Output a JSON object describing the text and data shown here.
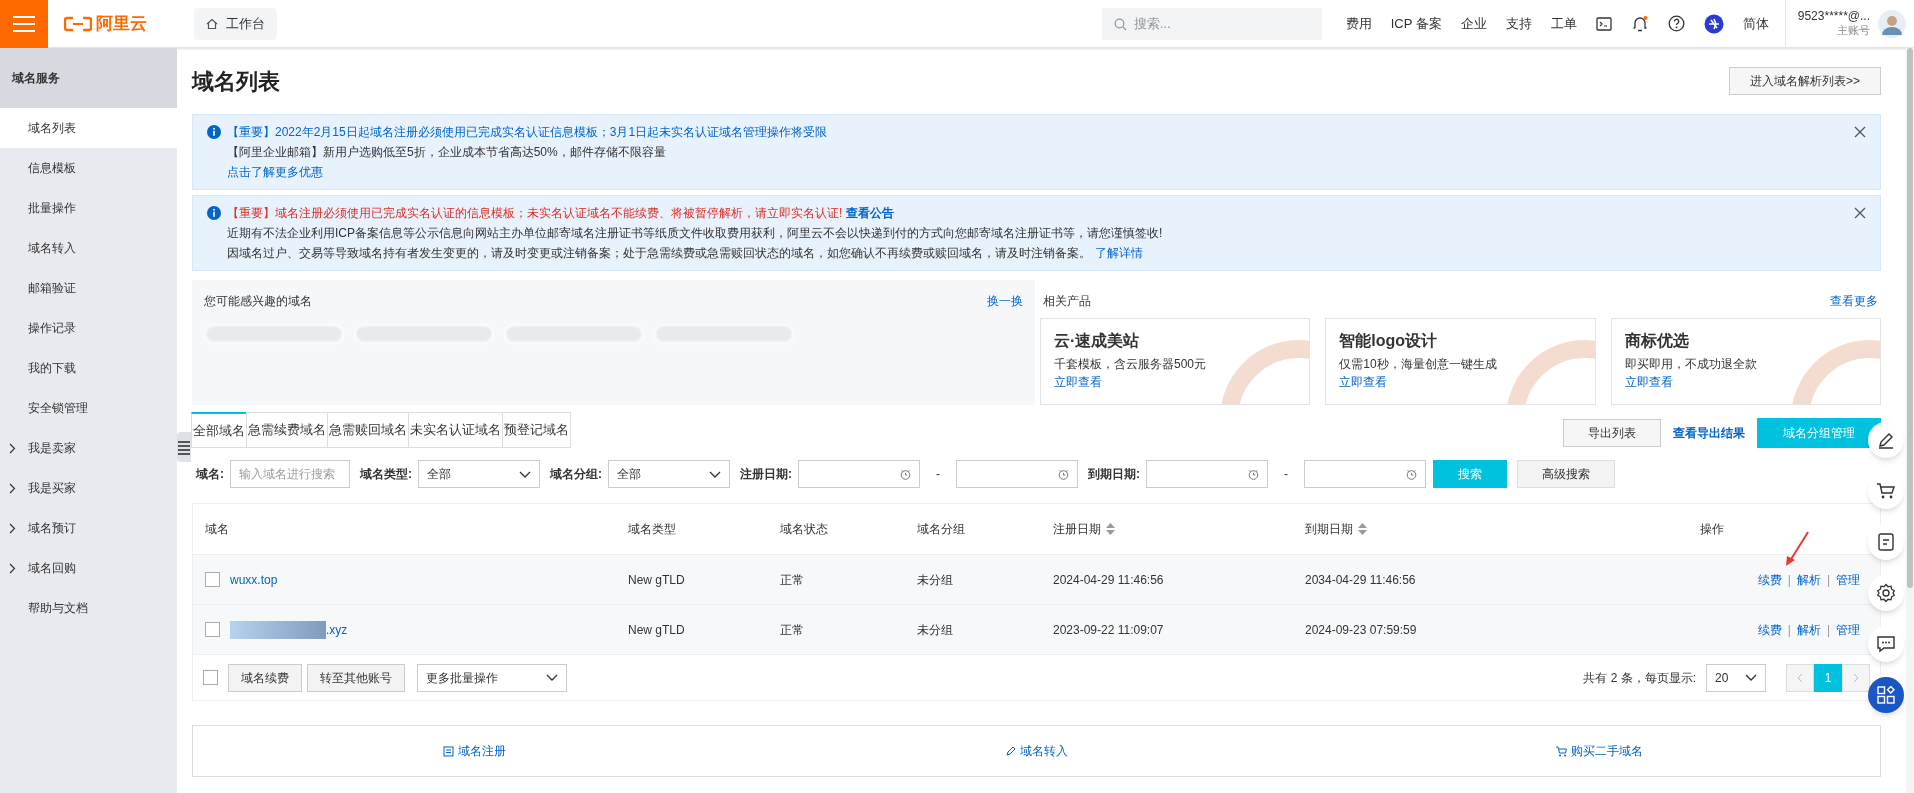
{
  "topbar": {
    "logo": "阿里云",
    "workbench": "工作台",
    "search_placeholder": "搜索...",
    "links": [
      "费用",
      "ICP 备案",
      "企业",
      "支持",
      "工单"
    ],
    "lang": "简体",
    "account": "9523*****@...",
    "account_role": "主账号"
  },
  "sidebar": {
    "title": "域名服务",
    "items": [
      {
        "label": "域名列表",
        "selected": true,
        "expandable": false
      },
      {
        "label": "信息模板",
        "selected": false,
        "expandable": false
      },
      {
        "label": "批量操作",
        "selected": false,
        "expandable": false
      },
      {
        "label": "域名转入",
        "selected": false,
        "expandable": false
      },
      {
        "label": "邮箱验证",
        "selected": false,
        "expandable": false
      },
      {
        "label": "操作记录",
        "selected": false,
        "expandable": false
      },
      {
        "label": "我的下载",
        "selected": false,
        "expandable": false
      },
      {
        "label": "安全锁管理",
        "selected": false,
        "expandable": false
      },
      {
        "label": "我是卖家",
        "selected": false,
        "expandable": true
      },
      {
        "label": "我是买家",
        "selected": false,
        "expandable": true
      },
      {
        "label": "域名预订",
        "selected": false,
        "expandable": true
      },
      {
        "label": "域名回购",
        "selected": false,
        "expandable": true
      },
      {
        "label": "帮助与文档",
        "selected": false,
        "expandable": false
      }
    ]
  },
  "page": {
    "title": "域名列表",
    "dns_button": "进入域名解析列表>>"
  },
  "notices": [
    {
      "lines": [
        {
          "text": "【重要】2022年2月15日起域名注册必须使用已完成实名认证信息模板；3月1日起未实名认证域名管理操作将受限",
          "kind": "blue"
        },
        {
          "text": "【阿里企业邮箱】新用户选购低至5折，企业成本节省高达50%，邮件存储不限容量",
          "kind": "plain"
        },
        {
          "text": "点击了解更多优惠",
          "kind": "link"
        }
      ]
    },
    {
      "lines": [
        {
          "text": "【重要】域名注册必须使用已完成实名认证的信息模板；未实名认证域名不能续费、将被暂停解析，请立即实名认证!",
          "kind": "red",
          "link": "查看公告"
        },
        {
          "text": "近期有不法企业利用ICP备案信息等公示信息向网站主办单位邮寄域名注册证书等纸质文件收取费用获利，阿里云不会以快递到付的方式向您邮寄域名注册证书等，请您谨慎签收!",
          "kind": "plain"
        },
        {
          "text": "因域名过户、交易等导致域名持有者发生变更的，请及时变更或注销备案；处于急需续费或急需赎回状态的域名，如您确认不再续费或赎回域名，请及时注销备案。",
          "kind": "plain",
          "link": "了解详情"
        }
      ]
    }
  ],
  "suggest": {
    "title": "您可能感兴趣的域名",
    "refresh": "换一换"
  },
  "products": {
    "title": "相关产品",
    "more": "查看更多",
    "items": [
      {
        "name": "云·速成美站",
        "desc": "千套模板，含云服务器500元",
        "link": "立即查看"
      },
      {
        "name": "智能logo设计",
        "desc": "仅需10秒，海量创意一键生成",
        "link": "立即查看"
      },
      {
        "name": "商标优选",
        "desc": "即买即用，不成功退全款",
        "link": "立即查看"
      }
    ]
  },
  "tabs": [
    {
      "label": "全部域名",
      "selected": true
    },
    {
      "label": "急需续费域名",
      "selected": false
    },
    {
      "label": "急需赎回域名",
      "selected": false
    },
    {
      "label": "未实名认证域名",
      "selected": false
    },
    {
      "label": "预登记域名",
      "selected": false
    }
  ],
  "actions": {
    "export": "导出列表",
    "view_export": "查看导出结果",
    "group_manage": "域名分组管理"
  },
  "filters": {
    "domain_label": "域名:",
    "domain_placeholder": "输入域名进行搜索",
    "type_label": "域名类型:",
    "type_value": "全部",
    "group_label": "域名分组:",
    "group_value": "全部",
    "reg_label": "注册日期:",
    "exp_label": "到期日期:",
    "dash": "-",
    "search": "搜索",
    "advanced": "高级搜索"
  },
  "table": {
    "columns": [
      {
        "label": "域名",
        "sortable": false
      },
      {
        "label": "域名类型",
        "sortable": false
      },
      {
        "label": "域名状态",
        "sortable": false
      },
      {
        "label": "域名分组",
        "sortable": false
      },
      {
        "label": "注册日期",
        "sortable": true
      },
      {
        "label": "到期日期",
        "sortable": true
      },
      {
        "label": "操作",
        "sortable": false
      }
    ],
    "rows": [
      {
        "checked": false,
        "domain": "wuxx.top",
        "redacted": false,
        "type": "New gTLD",
        "status": "正常",
        "group": "未分组",
        "registered": "2024-04-29 11:46:56",
        "expires": "2034-04-29 11:46:56",
        "ops": [
          {
            "kind": "link",
            "text": "续费"
          },
          {
            "kind": "separator",
            "text": "|"
          },
          {
            "kind": "link",
            "text": "解析"
          },
          {
            "kind": "separator",
            "text": "|"
          },
          {
            "kind": "link",
            "text": "管理"
          }
        ],
        "annotated": true
      },
      {
        "checked": false,
        "domain": ".xyz",
        "redacted": true,
        "type": "New gTLD",
        "status": "正常",
        "group": "未分组",
        "registered": "2023-09-22 11:09:07",
        "expires": "2024-09-23 07:59:59",
        "ops": [
          {
            "kind": "link",
            "text": "续费"
          },
          {
            "kind": "separator",
            "text": "|"
          },
          {
            "kind": "link",
            "text": "解析"
          },
          {
            "kind": "separator",
            "text": "|"
          },
          {
            "kind": "link",
            "text": "管理"
          }
        ],
        "annotated": false
      }
    ],
    "select_all_checked": false,
    "bulk_renew": "域名续费",
    "transfer": "转至其他账号",
    "more_bulk": "更多批量操作",
    "total": "共有 2 条，每页显示:",
    "page_size": "20",
    "pages": [
      {
        "label": "1",
        "selected": true
      }
    ]
  },
  "bottom_links": [
    "域名注册",
    "域名转入",
    "购买二手域名"
  ]
}
